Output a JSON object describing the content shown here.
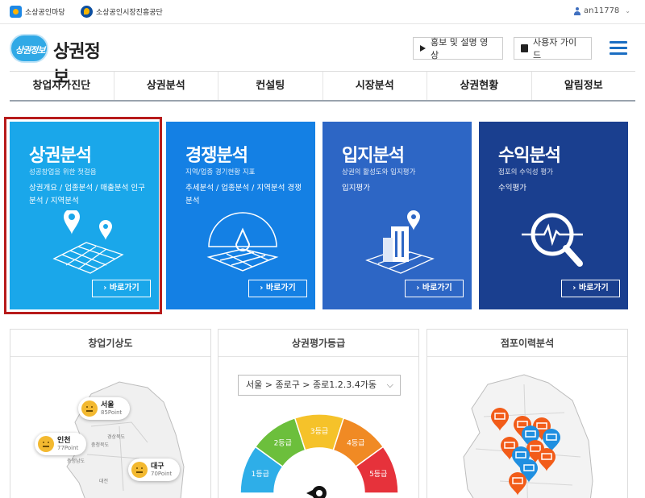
{
  "topbar": {
    "org1": "소상공인마당",
    "org2": "소상공인시장진흥공단",
    "username": "an11778",
    "chevron": "⌄"
  },
  "header": {
    "logo_badge": "상권정보",
    "logo_title": "상권정보",
    "video_button": "홍보 및 설명 영상",
    "guide_button": "사용자 가이드"
  },
  "nav": {
    "items": [
      "창업자가진단",
      "상권분석",
      "컨설팅",
      "시장분석",
      "상권현황",
      "알림정보"
    ]
  },
  "tiles": [
    {
      "title": "상권분석",
      "subtitle": "성공창업을 위한 첫걸음",
      "links": "상권개요 / 업종분석 / 매출분석 인구분석 / 지역분석",
      "button": "› 바로가기",
      "color": "#1aa7ea"
    },
    {
      "title": "경쟁분석",
      "subtitle": "지역/업종 경기현황 지표",
      "links": "추세분석 / 업종분석 / 지역분석 경쟁분석",
      "button": "› 바로가기",
      "color": "#1480e4"
    },
    {
      "title": "입지분석",
      "subtitle": "상권의 활성도와 입지평가",
      "links": "입지평가",
      "button": "› 바로가기",
      "color": "#2d66c5"
    },
    {
      "title": "수익분석",
      "subtitle": "점포의 수익성 평가",
      "links": "수익평가",
      "button": "› 바로가기",
      "color": "#1a3f8f"
    }
  ],
  "panels": {
    "weather": {
      "title": "창업기상도",
      "badges": [
        {
          "name": "서울",
          "point": "85Point"
        },
        {
          "name": "인천",
          "point": "77Point"
        },
        {
          "name": "대구",
          "point": "70Point"
        }
      ],
      "map_labels": [
        "충청북도",
        "충청남도",
        "경상북도",
        "대전"
      ]
    },
    "grade": {
      "title": "상권평가등급",
      "region": "서울 > 종로구 > 종로1.2.3.4가동",
      "grades": [
        "1등급",
        "2등급",
        "3등급",
        "4등급",
        "5등급"
      ],
      "colors": [
        "#2eaee8",
        "#6cbf3c",
        "#f5c22a",
        "#f08a24",
        "#e6323b"
      ]
    },
    "history": {
      "title": "점포이력분석",
      "marker_colors": [
        "#f25c19",
        "#1f8fe0"
      ]
    }
  }
}
